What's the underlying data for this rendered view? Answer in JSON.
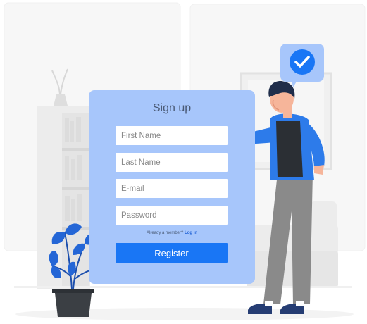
{
  "form": {
    "title": "Sign up",
    "first_name_placeholder": "First Name",
    "last_name_placeholder": "Last Name",
    "email_placeholder": "E-mail",
    "password_placeholder": "Password",
    "member_prompt": "Already a member?",
    "login_link": "Log in",
    "register_label": "Register"
  },
  "colors": {
    "card": "#a7c6fb",
    "accent": "#1976f5",
    "jacket": "#2d7bea",
    "pants": "#8a8a8a",
    "plant": "#2466d6",
    "pot": "#3b3f44",
    "background_shapes": "#f2f2f2"
  },
  "icons": {
    "badge": "check-circle-icon"
  }
}
